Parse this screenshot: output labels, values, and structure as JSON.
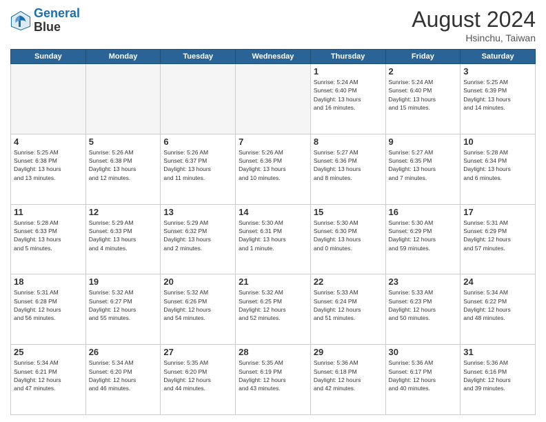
{
  "logo": {
    "line1": "General",
    "line2": "Blue"
  },
  "title": "August 2024",
  "location": "Hsinchu, Taiwan",
  "days_of_week": [
    "Sunday",
    "Monday",
    "Tuesday",
    "Wednesday",
    "Thursday",
    "Friday",
    "Saturday"
  ],
  "weeks": [
    [
      {
        "day": "",
        "info": ""
      },
      {
        "day": "",
        "info": ""
      },
      {
        "day": "",
        "info": ""
      },
      {
        "day": "",
        "info": ""
      },
      {
        "day": "1",
        "info": "Sunrise: 5:24 AM\nSunset: 6:40 PM\nDaylight: 13 hours\nand 16 minutes."
      },
      {
        "day": "2",
        "info": "Sunrise: 5:24 AM\nSunset: 6:40 PM\nDaylight: 13 hours\nand 15 minutes."
      },
      {
        "day": "3",
        "info": "Sunrise: 5:25 AM\nSunset: 6:39 PM\nDaylight: 13 hours\nand 14 minutes."
      }
    ],
    [
      {
        "day": "4",
        "info": "Sunrise: 5:25 AM\nSunset: 6:38 PM\nDaylight: 13 hours\nand 13 minutes."
      },
      {
        "day": "5",
        "info": "Sunrise: 5:26 AM\nSunset: 6:38 PM\nDaylight: 13 hours\nand 12 minutes."
      },
      {
        "day": "6",
        "info": "Sunrise: 5:26 AM\nSunset: 6:37 PM\nDaylight: 13 hours\nand 11 minutes."
      },
      {
        "day": "7",
        "info": "Sunrise: 5:26 AM\nSunset: 6:36 PM\nDaylight: 13 hours\nand 10 minutes."
      },
      {
        "day": "8",
        "info": "Sunrise: 5:27 AM\nSunset: 6:36 PM\nDaylight: 13 hours\nand 8 minutes."
      },
      {
        "day": "9",
        "info": "Sunrise: 5:27 AM\nSunset: 6:35 PM\nDaylight: 13 hours\nand 7 minutes."
      },
      {
        "day": "10",
        "info": "Sunrise: 5:28 AM\nSunset: 6:34 PM\nDaylight: 13 hours\nand 6 minutes."
      }
    ],
    [
      {
        "day": "11",
        "info": "Sunrise: 5:28 AM\nSunset: 6:33 PM\nDaylight: 13 hours\nand 5 minutes."
      },
      {
        "day": "12",
        "info": "Sunrise: 5:29 AM\nSunset: 6:33 PM\nDaylight: 13 hours\nand 4 minutes."
      },
      {
        "day": "13",
        "info": "Sunrise: 5:29 AM\nSunset: 6:32 PM\nDaylight: 13 hours\nand 2 minutes."
      },
      {
        "day": "14",
        "info": "Sunrise: 5:30 AM\nSunset: 6:31 PM\nDaylight: 13 hours\nand 1 minute."
      },
      {
        "day": "15",
        "info": "Sunrise: 5:30 AM\nSunset: 6:30 PM\nDaylight: 13 hours\nand 0 minutes."
      },
      {
        "day": "16",
        "info": "Sunrise: 5:30 AM\nSunset: 6:29 PM\nDaylight: 12 hours\nand 59 minutes."
      },
      {
        "day": "17",
        "info": "Sunrise: 5:31 AM\nSunset: 6:29 PM\nDaylight: 12 hours\nand 57 minutes."
      }
    ],
    [
      {
        "day": "18",
        "info": "Sunrise: 5:31 AM\nSunset: 6:28 PM\nDaylight: 12 hours\nand 56 minutes."
      },
      {
        "day": "19",
        "info": "Sunrise: 5:32 AM\nSunset: 6:27 PM\nDaylight: 12 hours\nand 55 minutes."
      },
      {
        "day": "20",
        "info": "Sunrise: 5:32 AM\nSunset: 6:26 PM\nDaylight: 12 hours\nand 54 minutes."
      },
      {
        "day": "21",
        "info": "Sunrise: 5:32 AM\nSunset: 6:25 PM\nDaylight: 12 hours\nand 52 minutes."
      },
      {
        "day": "22",
        "info": "Sunrise: 5:33 AM\nSunset: 6:24 PM\nDaylight: 12 hours\nand 51 minutes."
      },
      {
        "day": "23",
        "info": "Sunrise: 5:33 AM\nSunset: 6:23 PM\nDaylight: 12 hours\nand 50 minutes."
      },
      {
        "day": "24",
        "info": "Sunrise: 5:34 AM\nSunset: 6:22 PM\nDaylight: 12 hours\nand 48 minutes."
      }
    ],
    [
      {
        "day": "25",
        "info": "Sunrise: 5:34 AM\nSunset: 6:21 PM\nDaylight: 12 hours\nand 47 minutes."
      },
      {
        "day": "26",
        "info": "Sunrise: 5:34 AM\nSunset: 6:20 PM\nDaylight: 12 hours\nand 46 minutes."
      },
      {
        "day": "27",
        "info": "Sunrise: 5:35 AM\nSunset: 6:20 PM\nDaylight: 12 hours\nand 44 minutes."
      },
      {
        "day": "28",
        "info": "Sunrise: 5:35 AM\nSunset: 6:19 PM\nDaylight: 12 hours\nand 43 minutes."
      },
      {
        "day": "29",
        "info": "Sunrise: 5:36 AM\nSunset: 6:18 PM\nDaylight: 12 hours\nand 42 minutes."
      },
      {
        "day": "30",
        "info": "Sunrise: 5:36 AM\nSunset: 6:17 PM\nDaylight: 12 hours\nand 40 minutes."
      },
      {
        "day": "31",
        "info": "Sunrise: 5:36 AM\nSunset: 6:16 PM\nDaylight: 12 hours\nand 39 minutes."
      }
    ]
  ]
}
